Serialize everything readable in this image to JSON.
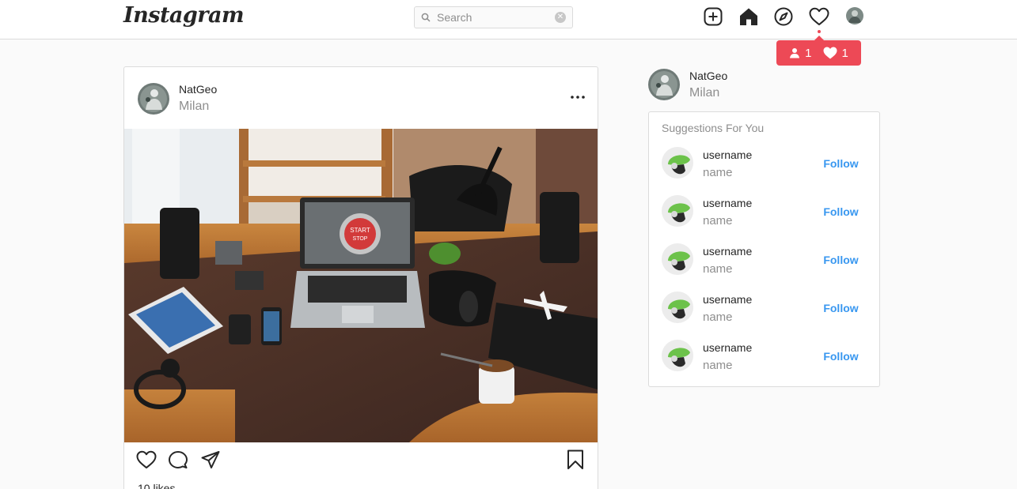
{
  "header": {
    "logo": "Instagram",
    "search_placeholder": "Search",
    "icons": [
      "add-post-icon",
      "home-icon",
      "explore-icon",
      "activity-heart-icon",
      "profile-avatar"
    ]
  },
  "notifications": {
    "followers_count": "1",
    "likes_count": "1",
    "color": "#ed4956"
  },
  "post": {
    "username": "NatGeo",
    "location": "Milan",
    "likes_text": "10 likes",
    "image_alt": "desk-workspace-photo"
  },
  "sidebar": {
    "username": "NatGeo",
    "location": "Milan",
    "suggestions_title": "Suggestions For You",
    "suggestions": [
      {
        "username": "username",
        "name": "name",
        "action": "Follow"
      },
      {
        "username": "username",
        "name": "name",
        "action": "Follow"
      },
      {
        "username": "username",
        "name": "name",
        "action": "Follow"
      },
      {
        "username": "username",
        "name": "name",
        "action": "Follow"
      },
      {
        "username": "username",
        "name": "name",
        "action": "Follow"
      }
    ]
  },
  "colors": {
    "accent_blue": "#3897f0",
    "border": "#dbdbdb",
    "background": "#fafafa",
    "notification_red": "#ed4956"
  }
}
